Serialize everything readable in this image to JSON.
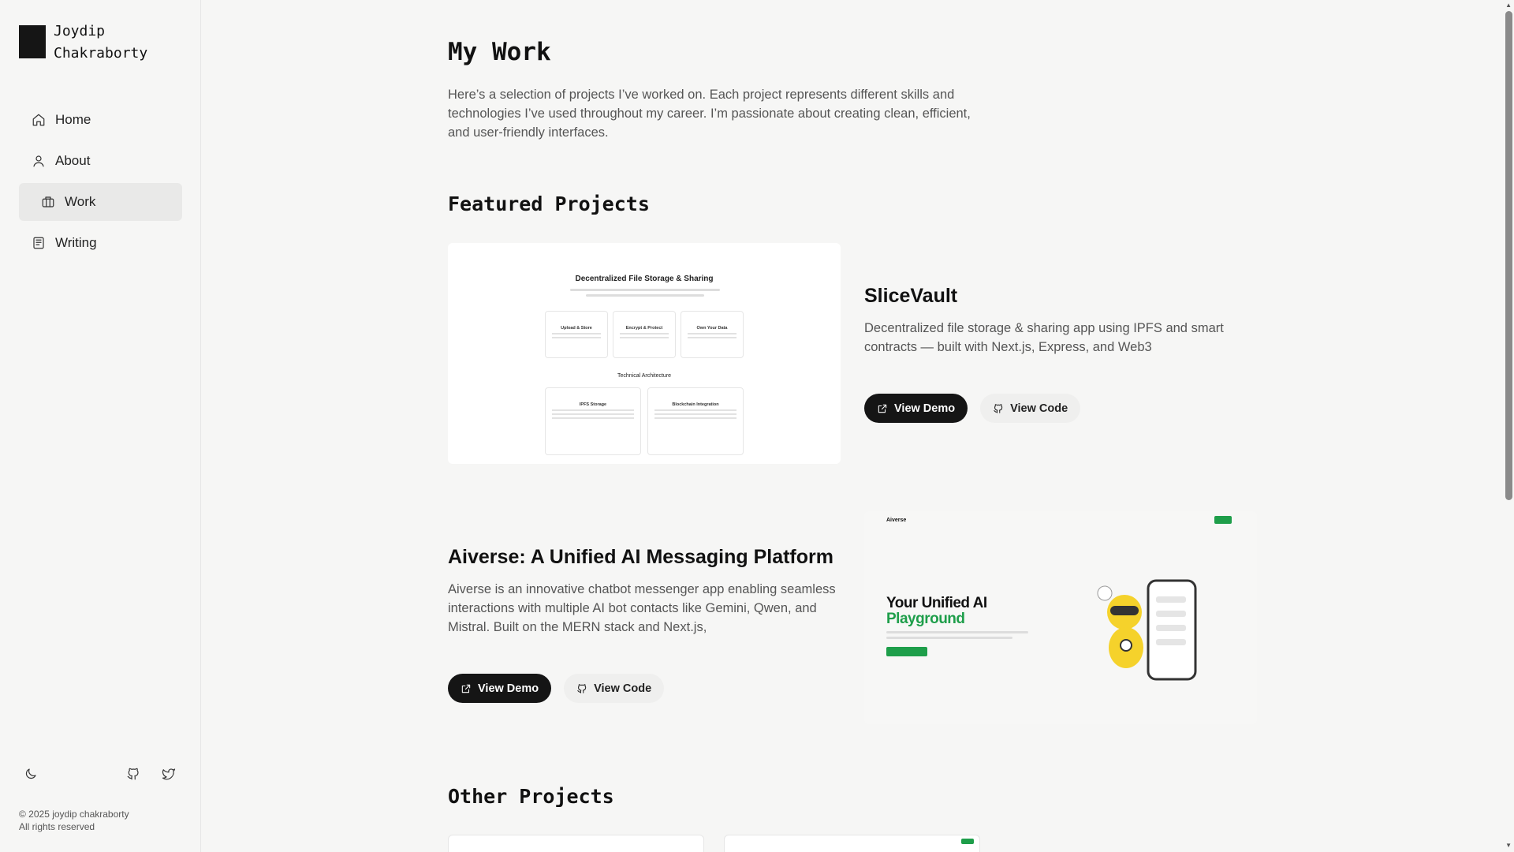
{
  "brand": {
    "name_line1": "Joydip",
    "name_line2": "Chakraborty"
  },
  "nav": {
    "items": [
      {
        "label": "Home",
        "icon": "home-icon"
      },
      {
        "label": "About",
        "icon": "user-icon"
      },
      {
        "label": "Work",
        "icon": "briefcase-icon",
        "active": true
      },
      {
        "label": "Writing",
        "icon": "newspaper-icon"
      }
    ]
  },
  "footer": {
    "icons": [
      "moon-icon",
      "github-icon",
      "twitter-icon"
    ],
    "copyright_line1": "© 2025 joydip chakraborty",
    "copyright_line2": "All rights reserved"
  },
  "main": {
    "title": "My Work",
    "intro": "Here’s a selection of projects I’ve worked on. Each project represents different skills and technologies I’ve used throughout my career. I’m passionate about creating clean, efficient, and user-friendly interfaces.",
    "featured_title": "Featured Projects",
    "other_title": "Other Projects",
    "projects": [
      {
        "title": "SliceVault",
        "description": "Decentralized file storage & sharing app using IPFS and smart contracts — built with Next.js, Express, and Web3",
        "demo_label": "View Demo",
        "code_label": "View Code",
        "preview": {
          "heading": "Decentralized File Storage & Sharing",
          "cards": [
            "Upload & Store",
            "Encrypt & Protect",
            "Own Your Data"
          ],
          "section": "Technical Architecture",
          "arch_cards": [
            "IPFS Storage",
            "Blockchain Integration"
          ]
        }
      },
      {
        "title": "Aiverse: A Unified AI Messaging Platform",
        "description": "Aiverse is an innovative chatbot messenger app enabling seamless interactions with multiple AI bot contacts like Gemini, Qwen, and Mistral. Built on the MERN stack and Next.js,",
        "demo_label": "View Demo",
        "code_label": "View Code",
        "preview": {
          "logo": "Aiverse",
          "hero_line1": "Your Unified AI",
          "hero_line2": "Playground",
          "accent": "#1e9e4a"
        }
      }
    ]
  }
}
